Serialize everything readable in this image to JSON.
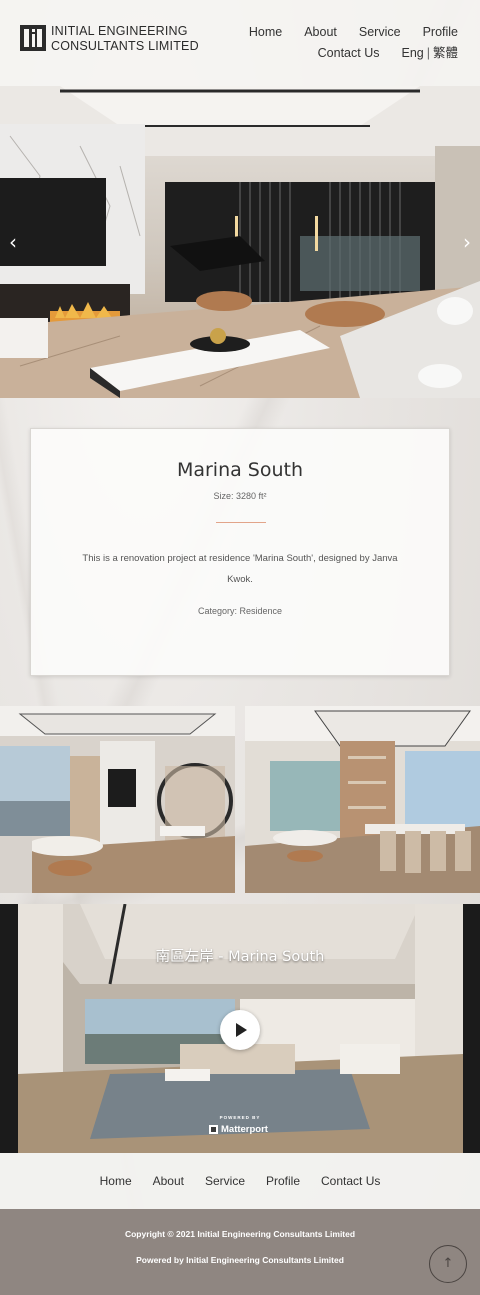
{
  "header": {
    "logo_line1": "INITIAL ENGINEERING",
    "logo_line2": "CONSULTANTS LIMITED",
    "logo_icon": "logo-icon",
    "nav": {
      "home": "Home",
      "about": "About",
      "service": "Service",
      "profile": "Profile",
      "contact": "Contact Us"
    },
    "lang": {
      "eng": "Eng",
      "sep": "|",
      "zh": "繁體"
    }
  },
  "hero": {
    "prev_icon": "chevron-left-icon",
    "next_icon": "chevron-right-icon",
    "prev_glyph": "‹",
    "next_glyph": "›"
  },
  "project": {
    "title": "Marina South",
    "size": "Size: 3280 ft²",
    "description": "This is a renovation project at residence 'Marina South', designed by Janva Kwok.",
    "category": "Category: Residence"
  },
  "video": {
    "title": "南區左岸 - Marina South",
    "powered_by": "POWERED BY",
    "brand": "Matterport",
    "play_icon": "play-icon"
  },
  "footer_nav": {
    "home": "Home",
    "about": "About",
    "service": "Service",
    "profile": "Profile",
    "contact": "Contact Us"
  },
  "footer": {
    "copyright": "Copyright © 2021 Initial Engineering Consultants Limited",
    "powered": "Powered by Initial Engineering Consultants Limited",
    "top_icon": "arrow-up-icon",
    "top_glyph": "↑"
  },
  "colors": {
    "accent_rule": "#e2a48a",
    "footer_bg": "#8f8681"
  }
}
